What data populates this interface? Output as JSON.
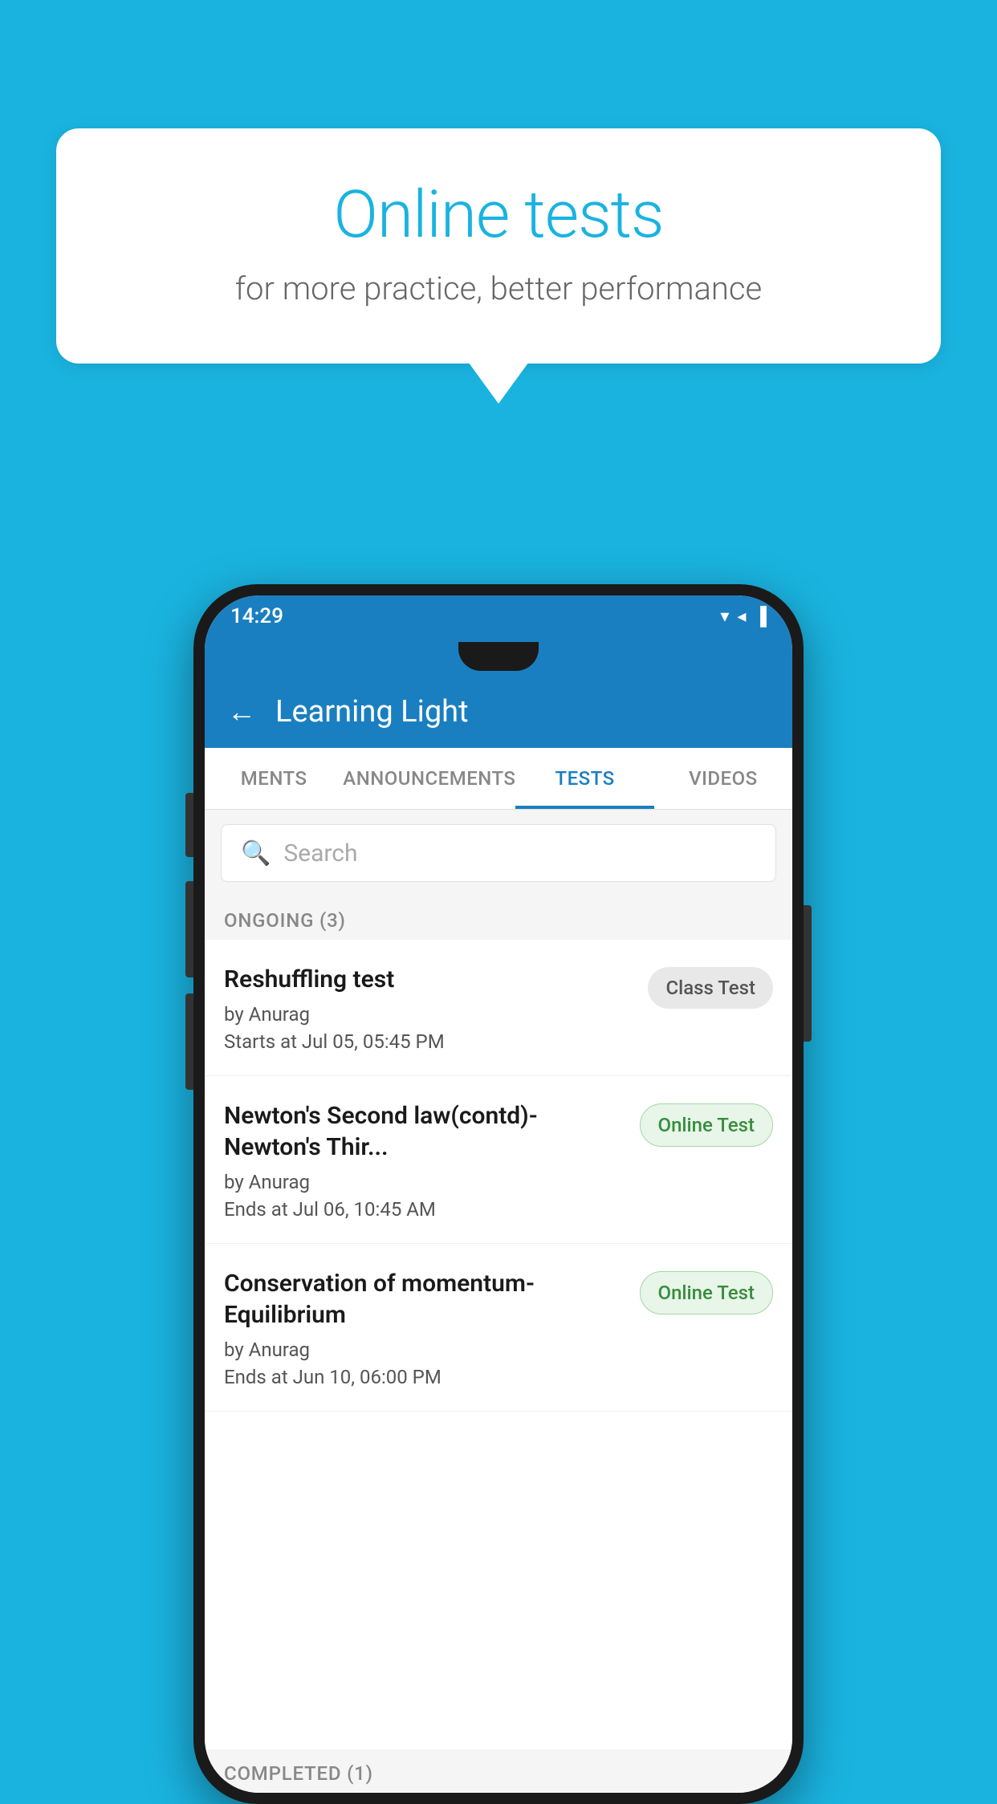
{
  "background_color": "#1ab3e0",
  "speech_bubble": {
    "title": "Online tests",
    "subtitle": "for more practice, better performance"
  },
  "status_bar": {
    "time": "14:29",
    "wifi": "▼",
    "signal": "▲",
    "battery": "▐"
  },
  "app_bar": {
    "back_label": "←",
    "title": "Learning Light"
  },
  "tabs": [
    {
      "label": "MENTS",
      "active": false
    },
    {
      "label": "ANNOUNCEMENTS",
      "active": false
    },
    {
      "label": "TESTS",
      "active": true
    },
    {
      "label": "VIDEOS",
      "active": false
    }
  ],
  "search": {
    "placeholder": "Search"
  },
  "ongoing_section": {
    "label": "ONGOING (3)"
  },
  "tests": [
    {
      "title": "Reshuffling test",
      "author": "by Anurag",
      "time": "Starts at  Jul 05, 05:45 PM",
      "badge": "Class Test",
      "badge_type": "class"
    },
    {
      "title": "Newton's Second law(contd)-Newton's Thir...",
      "author": "by Anurag",
      "time": "Ends at  Jul 06, 10:45 AM",
      "badge": "Online Test",
      "badge_type": "online"
    },
    {
      "title": "Conservation of momentum-Equilibrium",
      "author": "by Anurag",
      "time": "Ends at  Jun 10, 06:00 PM",
      "badge": "Online Test",
      "badge_type": "online"
    }
  ],
  "completed_section": {
    "label": "COMPLETED (1)"
  }
}
